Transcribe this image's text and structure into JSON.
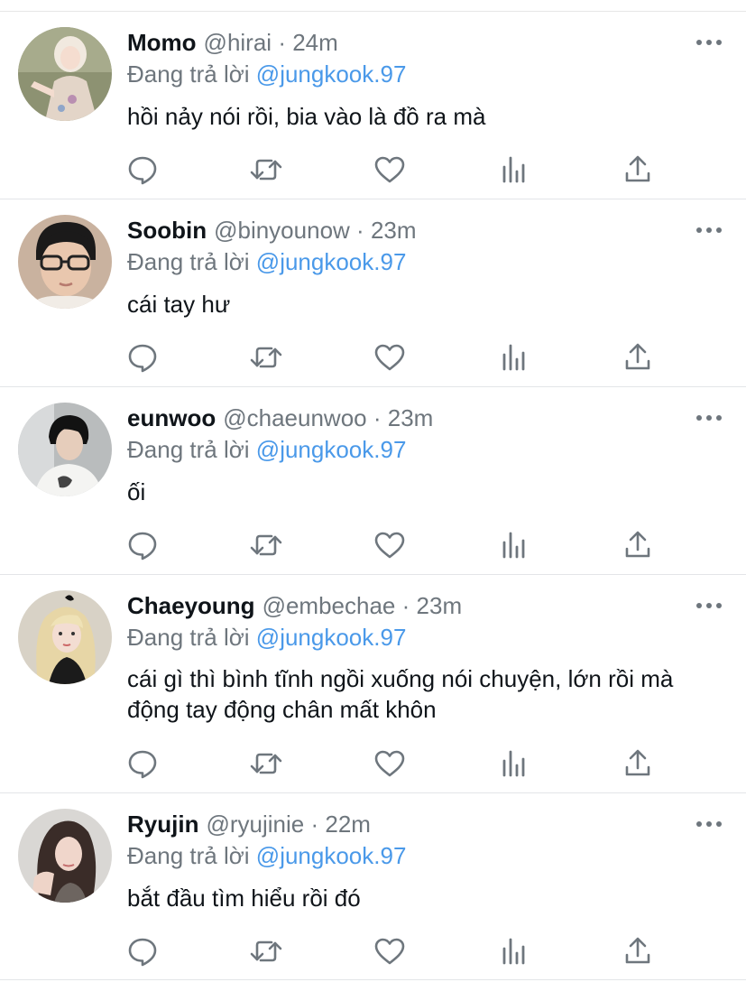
{
  "reply_prefix": "Đang trả lời",
  "replies": [
    {
      "name": "Momo",
      "handle": "@hirai",
      "separator": "·",
      "time": "24m",
      "replying_to": "@jungkook.97",
      "text": "hồi nảy nói rồi, bia vào là đồ ra mà",
      "avatar": "profile-photo"
    },
    {
      "name": "Soobin",
      "handle": "@binyounow",
      "separator": "·",
      "time": "23m",
      "replying_to": "@jungkook.97",
      "text": "cái tay hư",
      "avatar": "profile-photo"
    },
    {
      "name": "eunwoo",
      "handle": "@chaeunwoo",
      "separator": "·",
      "time": "23m",
      "replying_to": "@jungkook.97",
      "text": "ối",
      "avatar": "profile-photo"
    },
    {
      "name": "Chaeyoung",
      "handle": "@embechae",
      "separator": "·",
      "time": "23m",
      "replying_to": "@jungkook.97",
      "text": "cái gì thì bình tĩnh ngồi xuống nói chuyện, lớn rồi mà động tay động chân mất khôn",
      "avatar": "profile-photo"
    },
    {
      "name": "Ryujin",
      "handle": "@ryujinie",
      "separator": "·",
      "time": "22m",
      "replying_to": "@jungkook.97",
      "text": "bắt đầu tìm hiểu rồi đó",
      "avatar": "profile-photo"
    }
  ],
  "action_icons": [
    "reply-icon",
    "retweet-icon",
    "like-icon",
    "analytics-icon",
    "share-icon"
  ],
  "colors": {
    "text": "#0f1419",
    "secondary": "#6e767d",
    "mention": "#4a99e9",
    "icon": "#6e767d",
    "divider": "#e3e5e8"
  }
}
